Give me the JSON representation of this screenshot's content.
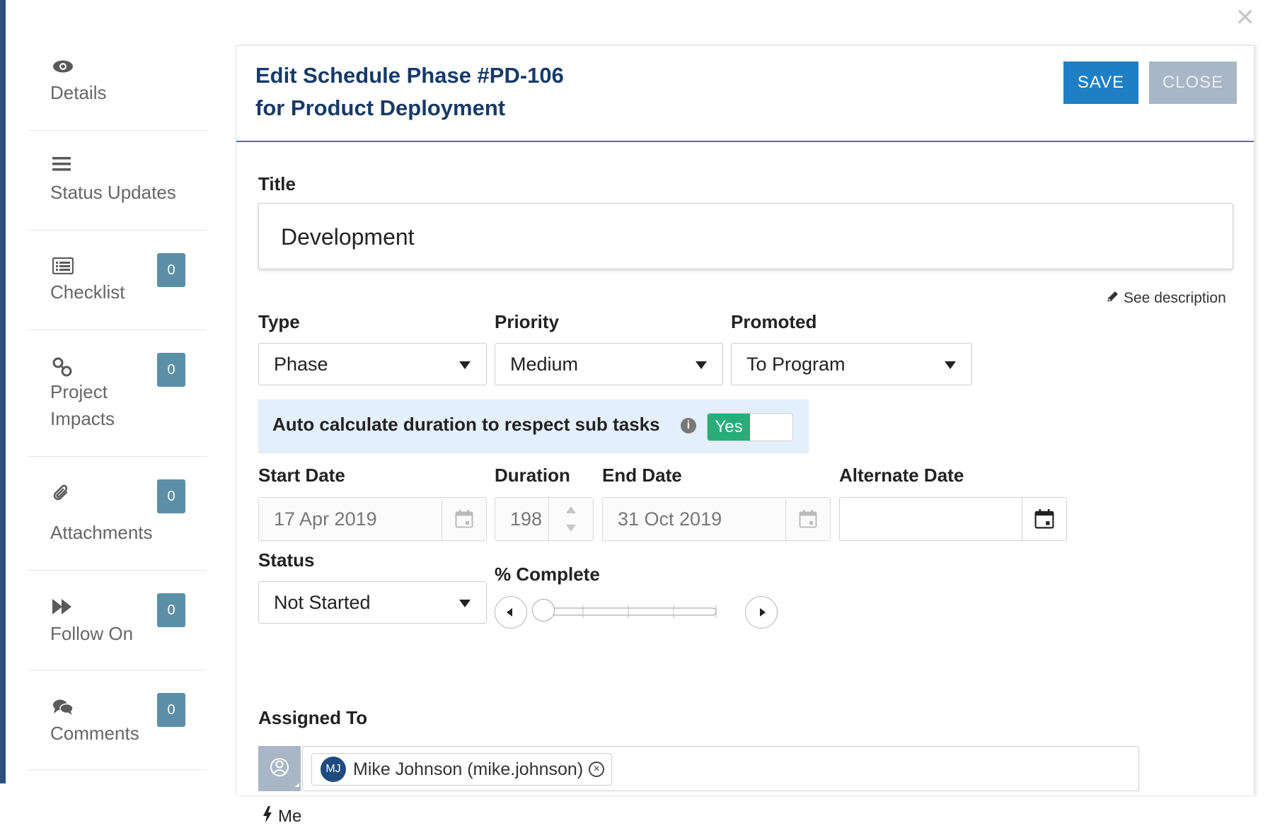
{
  "sidebar": {
    "items": [
      {
        "label": "Details",
        "icon": "eye-icon"
      },
      {
        "label": "Status Updates",
        "icon": "list-lines-icon"
      },
      {
        "label": "Checklist",
        "icon": "checklist-icon",
        "badge": "0"
      },
      {
        "label_line1": "Project",
        "label_line2": "Impacts",
        "icon": "link-icon",
        "badge": "0"
      },
      {
        "label": "Attachments",
        "icon": "paperclip-icon",
        "badge": "0"
      },
      {
        "label": "Follow On",
        "icon": "fast-forward-icon",
        "badge": "0"
      },
      {
        "label": "Comments",
        "icon": "comments-icon",
        "badge": "0"
      }
    ]
  },
  "header": {
    "title_line1": "Edit Schedule Phase #PD-106",
    "title_line2": "for Product Deployment",
    "save_label": "SAVE",
    "close_label": "CLOSE"
  },
  "form": {
    "title_label": "Title",
    "title_value": "Development",
    "see_description": "See description",
    "type_label": "Type",
    "type_value": "Phase",
    "priority_label": "Priority",
    "priority_value": "Medium",
    "promoted_label": "Promoted",
    "promoted_value": "To Program",
    "auto_calc_label": "Auto calculate duration to respect sub tasks",
    "auto_calc_toggle": "Yes",
    "start_date_label": "Start Date",
    "start_date_value": "17 Apr 2019",
    "duration_label": "Duration",
    "duration_value": "198",
    "end_date_label": "End Date",
    "end_date_value": "31 Oct 2019",
    "alternate_date_label": "Alternate Date",
    "alternate_date_value": "",
    "status_label": "Status",
    "status_value": "Not Started",
    "complete_label": "% Complete",
    "complete_value": 0,
    "assigned_label": "Assigned To",
    "assignee_initials": "MJ",
    "assignee_name": "Mike Johnson (mike.johnson)",
    "me_link": "Me"
  },
  "colors": {
    "primary": "#1f7fc4",
    "title": "#173a67",
    "badge": "#5b8fa8",
    "toggle_on": "#27ad7a",
    "highlight": "#e3effa"
  }
}
